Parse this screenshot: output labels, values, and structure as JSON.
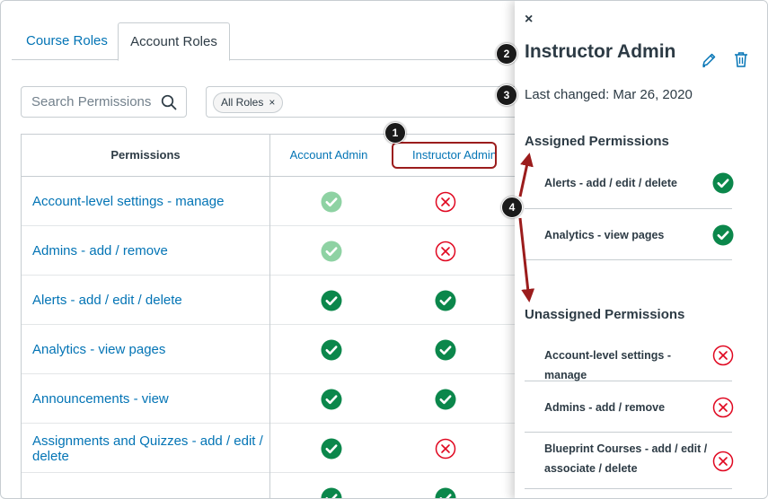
{
  "tabs": [
    {
      "label": "Course Roles",
      "active": false
    },
    {
      "label": "Account Roles",
      "active": true
    }
  ],
  "search": {
    "placeholder": "Search Permissions",
    "icon": "search-icon"
  },
  "filter": {
    "chip_label": "All Roles",
    "remove_icon": "×"
  },
  "table": {
    "headers": {
      "permissions": "Permissions",
      "role1": "Account Admin",
      "role2": "Instructor Admin"
    },
    "rows": [
      {
        "name": "Account-level settings - manage",
        "account_admin": "enabled-locked",
        "instructor_admin": "disabled"
      },
      {
        "name": "Admins - add / remove",
        "account_admin": "enabled-locked",
        "instructor_admin": "disabled"
      },
      {
        "name": "Alerts - add / edit / delete",
        "account_admin": "enabled",
        "instructor_admin": "enabled"
      },
      {
        "name": "Analytics - view pages",
        "account_admin": "enabled",
        "instructor_admin": "enabled"
      },
      {
        "name": "Announcements - view",
        "account_admin": "enabled",
        "instructor_admin": "enabled"
      },
      {
        "name": "Assignments and Quizzes - add / edit / delete",
        "account_admin": "enabled",
        "instructor_admin": "disabled"
      },
      {
        "name": "",
        "account_admin": "enabled",
        "instructor_admin": "enabled"
      }
    ]
  },
  "tray": {
    "close_icon": "×",
    "title": "Instructor Admin",
    "last_changed": "Last changed: Mar 26, 2020",
    "assigned_heading": "Assigned Permissions",
    "assigned": [
      {
        "label": "Alerts - add / edit / delete",
        "status": "enabled"
      },
      {
        "label": "Analytics - view pages",
        "status": "enabled"
      }
    ],
    "unassigned_heading": "Unassigned Permissions",
    "unassigned": [
      {
        "label": "Account-level settings - manage",
        "status": "disabled"
      },
      {
        "label": "Admins - add / remove",
        "status": "disabled"
      },
      {
        "label": "Blueprint Courses - add / edit / associate / delete",
        "status": "disabled"
      }
    ]
  },
  "callouts": [
    "1",
    "2",
    "3",
    "4"
  ],
  "colors": {
    "link": "#0374b5",
    "enabled": "#0b874b",
    "enabled_locked": "#8ed2a3",
    "disabled": "#e0061f",
    "annotation": "#9b1c1c"
  }
}
